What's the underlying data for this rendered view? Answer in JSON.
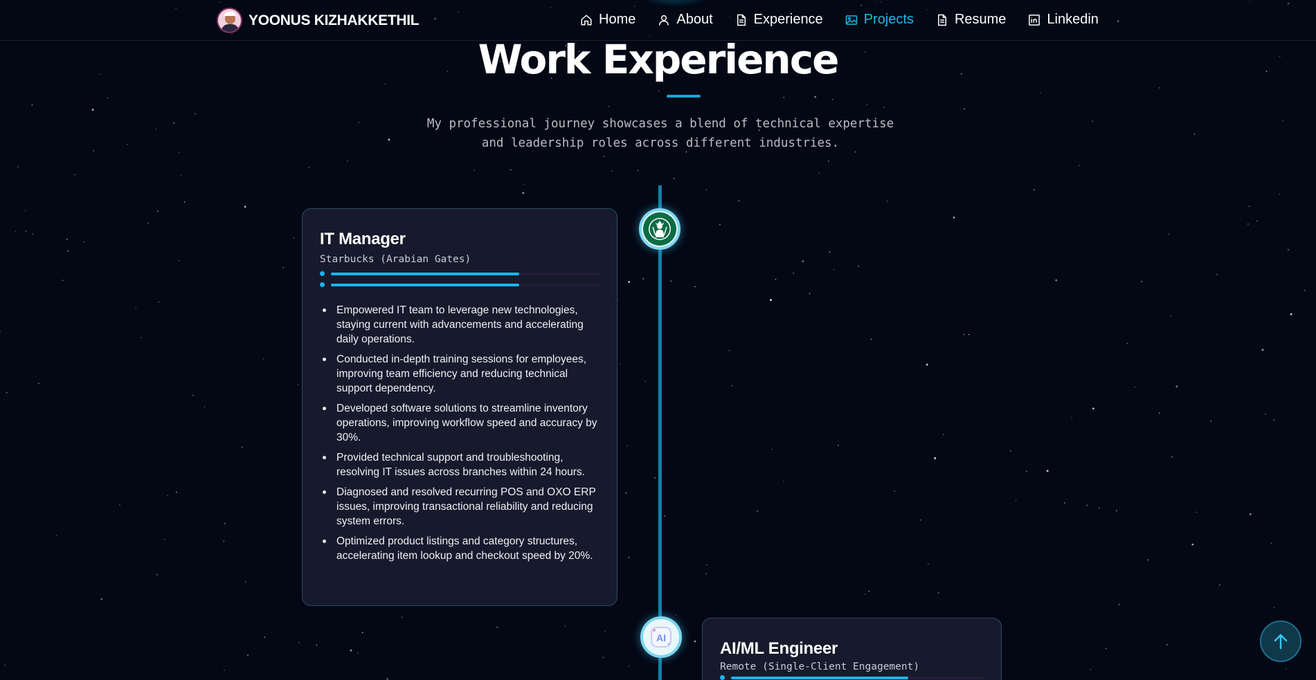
{
  "brand": {
    "name": "YOONUS KIZHAKKETHIL"
  },
  "nav": {
    "items": [
      {
        "label": "Home",
        "icon": "home-icon",
        "active": false
      },
      {
        "label": "About",
        "icon": "user-icon",
        "active": false
      },
      {
        "label": "Experience",
        "icon": "document-icon",
        "active": false
      },
      {
        "label": "Projects",
        "icon": "image-icon",
        "active": true
      },
      {
        "label": "Resume",
        "icon": "document-icon",
        "active": false
      },
      {
        "label": "Linkedin",
        "icon": "linkedin-icon",
        "active": false
      }
    ]
  },
  "section": {
    "title": "Work Experience",
    "subtitle_line1": "My professional journey showcases a blend of technical expertise",
    "subtitle_line2": "and leadership roles across different industries."
  },
  "experiences": [
    {
      "title": "IT Manager",
      "company": "Starbucks (Arabian Gates)",
      "icon": "starbucks-logo-icon",
      "progress": [
        0.7,
        0.7
      ],
      "bullets": [
        "Empowered IT team to leverage new technologies, staying current with advancements and accelerating daily operations.",
        "Conducted in-depth training sessions for employees, improving team efficiency and reducing technical support dependency.",
        "Developed software solutions to streamline inventory operations, improving workflow speed and accuracy by 30%.",
        "Provided technical support and troubleshooting, resolving IT issues across branches within 24 hours.",
        "Diagnosed and resolved recurring POS and OXO ERP issues, improving transactional reliability and reducing system errors.",
        "Optimized product listings and category structures, accelerating item lookup and checkout speed by 20%."
      ]
    },
    {
      "title": "AI/ML Engineer",
      "company": "Remote (Single-Client Engagement)",
      "icon": "ai-logo-icon",
      "progress": [
        0.7
      ]
    }
  ],
  "colors": {
    "background": "#040815",
    "accent": "#1fb8e8",
    "card": "#171a2c",
    "timeline": "#1380a6"
  },
  "scroll_top": {
    "icon": "arrow-up-icon"
  }
}
